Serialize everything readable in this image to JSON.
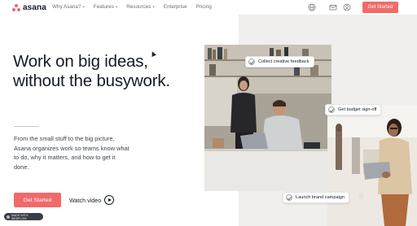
{
  "nav": {
    "logo_text": "asana",
    "links": [
      {
        "label": "Why Asana?",
        "has_dropdown": true
      },
      {
        "label": "Features",
        "has_dropdown": true
      },
      {
        "label": "Resources",
        "has_dropdown": true
      },
      {
        "label": "Enterprise",
        "has_dropdown": false
      },
      {
        "label": "Pricing",
        "has_dropdown": false
      }
    ],
    "icons": [
      "globe-icon",
      "mail-icon",
      "user-icon"
    ],
    "cta_label": "Get Started"
  },
  "hero": {
    "headline_line1": "Work on big ideas,",
    "headline_line2": "without the busywork.",
    "subtext": "From the small stuff to the big picture, Asana organizes work so teams know what to do, why it matters, and how to get it done.",
    "cta_label": "Get Started",
    "watch_label": "Watch video"
  },
  "tasks": [
    {
      "label": "Collect creative feedback"
    },
    {
      "label": "Get budget sign-off"
    },
    {
      "label": "Launch brand campaign"
    }
  ],
  "badge": {
    "label": "MADE WITH WEBFLOW"
  },
  "colors": {
    "accent": "#f06a6a",
    "text": "#151b26",
    "panel": "#f0efed"
  }
}
